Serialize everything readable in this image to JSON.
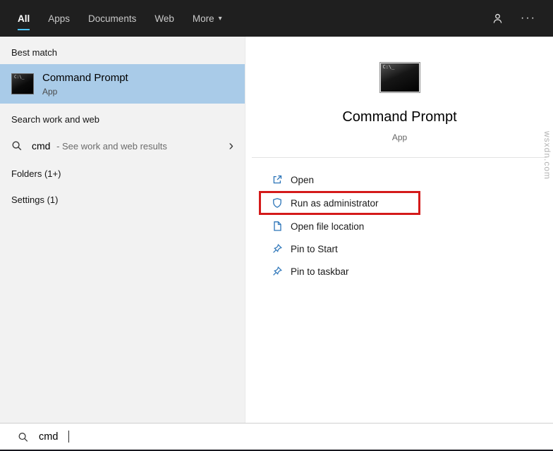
{
  "topbar": {
    "tabs": [
      {
        "label": "All",
        "active": true
      },
      {
        "label": "Apps",
        "active": false
      },
      {
        "label": "Documents",
        "active": false
      },
      {
        "label": "Web",
        "active": false
      },
      {
        "label": "More",
        "active": false,
        "has_dropdown": true
      }
    ]
  },
  "icons": {
    "chevron_down": "▾",
    "chevron_right": "›",
    "ellipsis": "···"
  },
  "left_panel": {
    "best_match_header": "Best match",
    "best_match": {
      "title": "Command Prompt",
      "subtitle": "App"
    },
    "search_header": "Search work and web",
    "web_search": {
      "query": "cmd",
      "suffix": " - See work and web results"
    },
    "folders_group": "Folders (1+)",
    "settings_group": "Settings (1)"
  },
  "right_panel": {
    "app_title": "Command Prompt",
    "app_subtitle": "App",
    "cmd_icon_text": "C:\\_",
    "actions": [
      {
        "label": "Open",
        "icon": "open-icon",
        "highlighted": false
      },
      {
        "label": "Run as administrator",
        "icon": "shield-icon",
        "highlighted": true
      },
      {
        "label": "Open file location",
        "icon": "file-location-icon",
        "highlighted": false
      },
      {
        "label": "Pin to Start",
        "icon": "pin-icon",
        "highlighted": false
      },
      {
        "label": "Pin to taskbar",
        "icon": "pin-icon",
        "highlighted": false
      }
    ]
  },
  "search_bar": {
    "value": "cmd"
  },
  "watermark": "wsxdn.com",
  "colors": {
    "topbar_bg": "#1f1f1f",
    "accent_underline": "#4cc2ff",
    "selection_bg": "#a9cbe8",
    "left_panel_bg": "#f2f2f2",
    "highlight_border": "#d41a1a",
    "action_icon": "#2b74b8"
  }
}
